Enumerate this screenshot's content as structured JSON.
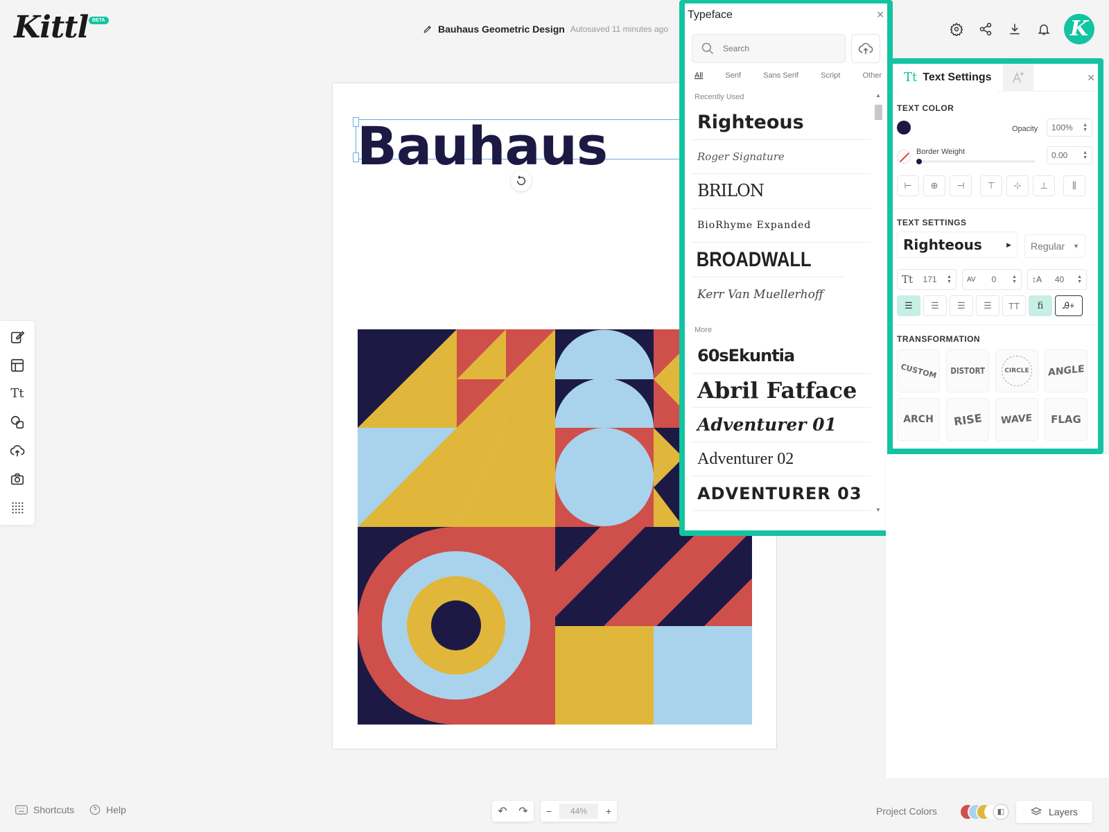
{
  "app": {
    "logo": "Kittl",
    "badge": "BETA",
    "avatar_letter": "K"
  },
  "document": {
    "title": "Bauhaus Geometric Design",
    "status": "Autosaved 11 minutes ago"
  },
  "canvas": {
    "headline": "Bauhaus"
  },
  "colors": {
    "accent": "#14c3a1",
    "navy": "#1c1a44",
    "red": "#cf4f4b",
    "yellow": "#e0b73a",
    "blue": "#a9d3ec"
  },
  "typeface_panel": {
    "title": "Typeface",
    "search_placeholder": "Search",
    "tabs": [
      "All",
      "Serif",
      "Sans Serif",
      "Script",
      "Other"
    ],
    "active_tab": "All",
    "recent_label": "Recently Used",
    "recent": [
      "Righteous",
      "Roger Signature",
      "BRILON",
      "BioRhyme Expanded",
      "BROADWALL",
      "Kerr Van Muellerhoff"
    ],
    "more_label": "More",
    "more": [
      "60sEkuntia",
      "Abril Fatface",
      "Adventurer 01",
      "Adventurer 02",
      "ADVENTURER 03"
    ]
  },
  "text_settings": {
    "title": "Text Settings",
    "text_color_label": "TEXT COLOR",
    "text_color": "#1c1a44",
    "opacity_label": "Opacity",
    "opacity_value": "100%",
    "border_weight_label": "Border Weight",
    "border_weight_value": "0.00",
    "settings_label": "TEXT SETTINGS",
    "font_name": "Righteous",
    "font_weight": "Regular",
    "font_size": "171",
    "letter_spacing": "0",
    "line_height": "40",
    "case_button": "TT",
    "ligature_button": "fi",
    "transformation_label": "TRANSFORMATION",
    "transforms": [
      "CUSTOM",
      "DISTORT",
      "CIRCLE",
      "ANGLE",
      "ARCH",
      "RISE",
      "WAVE",
      "FLAG"
    ]
  },
  "footer": {
    "shortcuts": "Shortcuts",
    "help": "Help",
    "zoom": "44%",
    "project_colors": "Project Colors",
    "layers": "Layers"
  }
}
